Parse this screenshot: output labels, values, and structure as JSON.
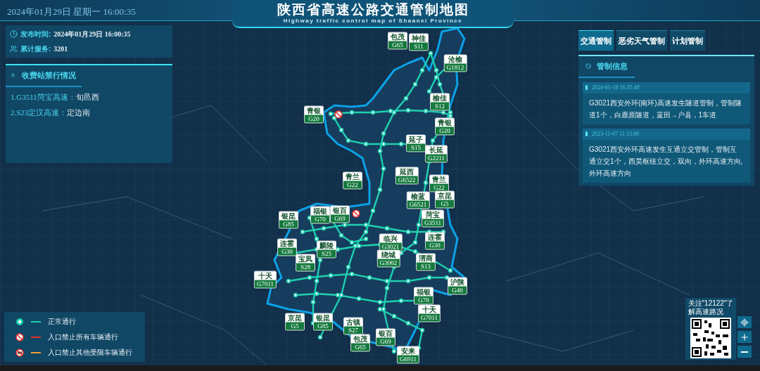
{
  "header": {
    "date_time": "2024年01月29日 星期一  16:00:35",
    "title": "陕西省高速公路交通管制地图",
    "subtitle": "Highway traffic control map of Shaanxi Province"
  },
  "publish_panel": {
    "publish_label": "发布时间:",
    "publish_value": "2024年01月29日  16:00:35",
    "service_label": "累计服务:",
    "service_value": "3201"
  },
  "closures_panel": {
    "title": "收费站禁行情况",
    "items": [
      {
        "route": "1.G3511菏宝高速：",
        "station": "旬邑西"
      },
      {
        "route": "2.S23定汉高速：",
        "station": "定边南"
      }
    ]
  },
  "tabs": [
    {
      "label": "交通管制",
      "selected": true
    },
    {
      "label": "恶劣天气管制",
      "selected": false
    },
    {
      "label": "计划管制",
      "selected": false
    }
  ],
  "control_panel": {
    "title": "管制信息",
    "notices": [
      {
        "time": "2024-01-18 16:35:48",
        "text": "G3021西安外环(南环)高速发生隧道管制，管制隧道1个，白鹿原隧道，蓝田→户县，1车道"
      },
      {
        "time": "2023-11-07 11:13:00",
        "text": "G3021西安外环高速发生互通立交管制，管制互通立交1个，西昊枢纽立交，双向，外环高速方向,外环高速方向"
      }
    ]
  },
  "map": {
    "signs": [
      {
        "name": "包茂",
        "code": "G65"
      },
      {
        "name": "神佳",
        "code": "S11"
      },
      {
        "name": "沧榆",
        "code": "G1812"
      },
      {
        "name": "青银",
        "code": "G20"
      },
      {
        "name": "榆佳",
        "code": "S12"
      },
      {
        "name": "青银",
        "code": "G20"
      },
      {
        "name": "延子",
        "code": "S15"
      },
      {
        "name": "长延",
        "code": "G2211"
      },
      {
        "name": "青兰",
        "code": "G22"
      },
      {
        "name": "延西",
        "code": "G6522"
      },
      {
        "name": "青兰",
        "code": "G22"
      },
      {
        "name": "榆蓝",
        "code": "G6521"
      },
      {
        "name": "京昆",
        "code": "G5"
      },
      {
        "name": "菏宝",
        "code": "G3511"
      },
      {
        "name": "银昆",
        "code": "G85"
      },
      {
        "name": "福银",
        "code": "G70"
      },
      {
        "name": "银百",
        "code": "G69"
      },
      {
        "name": "连霍",
        "code": "G30"
      },
      {
        "name": "麟陵",
        "code": "S25"
      },
      {
        "name": "临兴",
        "code": "G3021"
      },
      {
        "name": "连霍",
        "code": "G30"
      },
      {
        "name": "绕城",
        "code": "G3002"
      },
      {
        "name": "宝凤",
        "code": "S28"
      },
      {
        "name": "渭商",
        "code": "S13"
      },
      {
        "name": "十天",
        "code": "G7011"
      },
      {
        "name": "沪陕",
        "code": "G40"
      },
      {
        "name": "福银",
        "code": "G70"
      },
      {
        "name": "十天",
        "code": "G7011"
      },
      {
        "name": "京昆",
        "code": "G5"
      },
      {
        "name": "银昆",
        "code": "G85"
      },
      {
        "name": "古镇",
        "code": "S27"
      },
      {
        "name": "包茂",
        "code": "G65"
      },
      {
        "name": "银百",
        "code": "G69"
      },
      {
        "name": "安来",
        "code": "G6911"
      }
    ]
  },
  "legend": [
    {
      "kind": "normal",
      "color": "#1fd0b0",
      "label": "正常通行"
    },
    {
      "kind": "closed_all",
      "color": "#e0302c",
      "label": "入口禁止所有车辆通行"
    },
    {
      "kind": "closed_restricted",
      "color": "#f0a030",
      "label": "入口禁止其他受限车辆通行"
    }
  ],
  "qr_card": {
    "caption_lines": [
      "关注\"12122\"了",
      "解高速路况"
    ]
  }
}
